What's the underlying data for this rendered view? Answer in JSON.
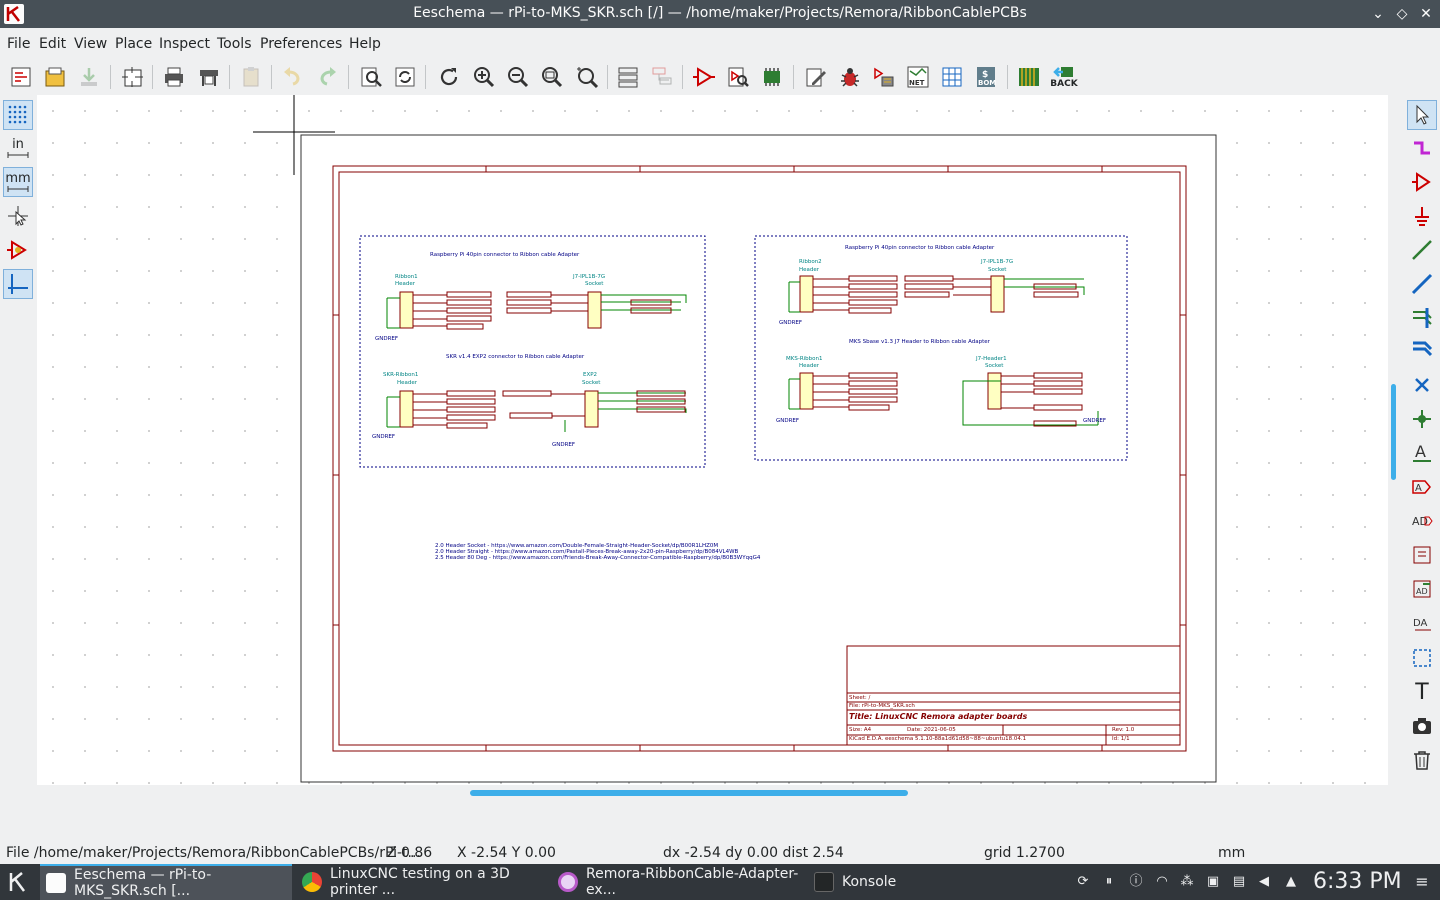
{
  "window": {
    "title": "Eeschema — rPi-to-MKS_SKR.sch [/] — /home/maker/Projects/Remora/RibbonCablePCBs",
    "controls": [
      "⌄",
      "◇",
      "✕"
    ]
  },
  "menu": [
    "File",
    "Edit",
    "View",
    "Place",
    "Inspect",
    "Tools",
    "Preferences",
    "Help"
  ],
  "toolbar": {
    "back_label": "BACK"
  },
  "lefttools": {
    "units_in": "in",
    "units_mm": "mm"
  },
  "righttools": {
    "text_tool": "T"
  },
  "sheet": {
    "cells": {
      "tl_title": "Raspberry Pi 40pin connector to Ribbon cable Adapter",
      "tl_ribbon": "Ribbon1",
      "tl_header": "Header",
      "tl_j7": "J7-IPL1B-7G",
      "tl_socket": "Socket",
      "gnd": "GNDREF",
      "bl_title": "SKR v1.4 EXP2 connector to Ribbon cable Adapter",
      "bl_ribbon": "SKR-Ribbon1",
      "bl_exp2": "EXP2",
      "tr_title": "Raspberry Pi 40pin connector to Ribbon cable Adapter",
      "tr_ribbon": "Ribbon2",
      "br_title": "MKS Sbase v1.3 J7 Header to Ribbon cable Adapter",
      "br_ribbon": "MKS-Ribbon1",
      "br_j7": "J7-Header1"
    },
    "notes": [
      "2.0 Header Socket - https://www.amazon.com/Double-Female-Straight-Header-Socket/dp/B00R1LHZ0M",
      "2.0 Header Straight - https://www.amazon.com/Pastall-Pieces-Break-away-2x20-pin-Raspberry/dp/B084VL4WB",
      "2.5 Header 80 Deg - https://www.amazon.com/Friends-Break-Away-Connector-Compatible-Raspberry/dp/B0B3WYqqG4"
    ],
    "titleblock": {
      "sheet": "Sheet: /",
      "file": "File: rPi-to-MKS_SKR.sch",
      "title": "Title: LinuxCNC Remora adapter boards",
      "size": "Size: A4",
      "date": "Date: 2021-06-05",
      "rev": "Rev: 1.0",
      "kicad": "KiCad E.D.A.  eeschema 5.1.10-88a1d61d58~88~ubuntu18.04.1",
      "id": "Id: 1/1"
    }
  },
  "status": {
    "file": "File /home/maker/Projects/Remora/RibbonCablePCBs/rPi-t...",
    "zoom": "Z 0.86",
    "xy": "X -2.54  Y 0.00",
    "delta": "dx -2.54  dy 0.00  dist 2.54",
    "grid": "grid 1.2700",
    "units": "mm"
  },
  "taskbar": {
    "items": [
      "Eeschema — rPi-to-MKS_SKR.sch [...",
      "LinuxCNC testing on a 3D printer ...",
      "Remora-RibbonCable-Adapter-ex...",
      "Konsole"
    ],
    "clock": "6:33 PM"
  },
  "colors": {
    "accent": "#3daee9",
    "sheet_border": "#840000",
    "wire": "#008400",
    "label_text": "#000084",
    "grid_dot": "#a8a8a8"
  }
}
